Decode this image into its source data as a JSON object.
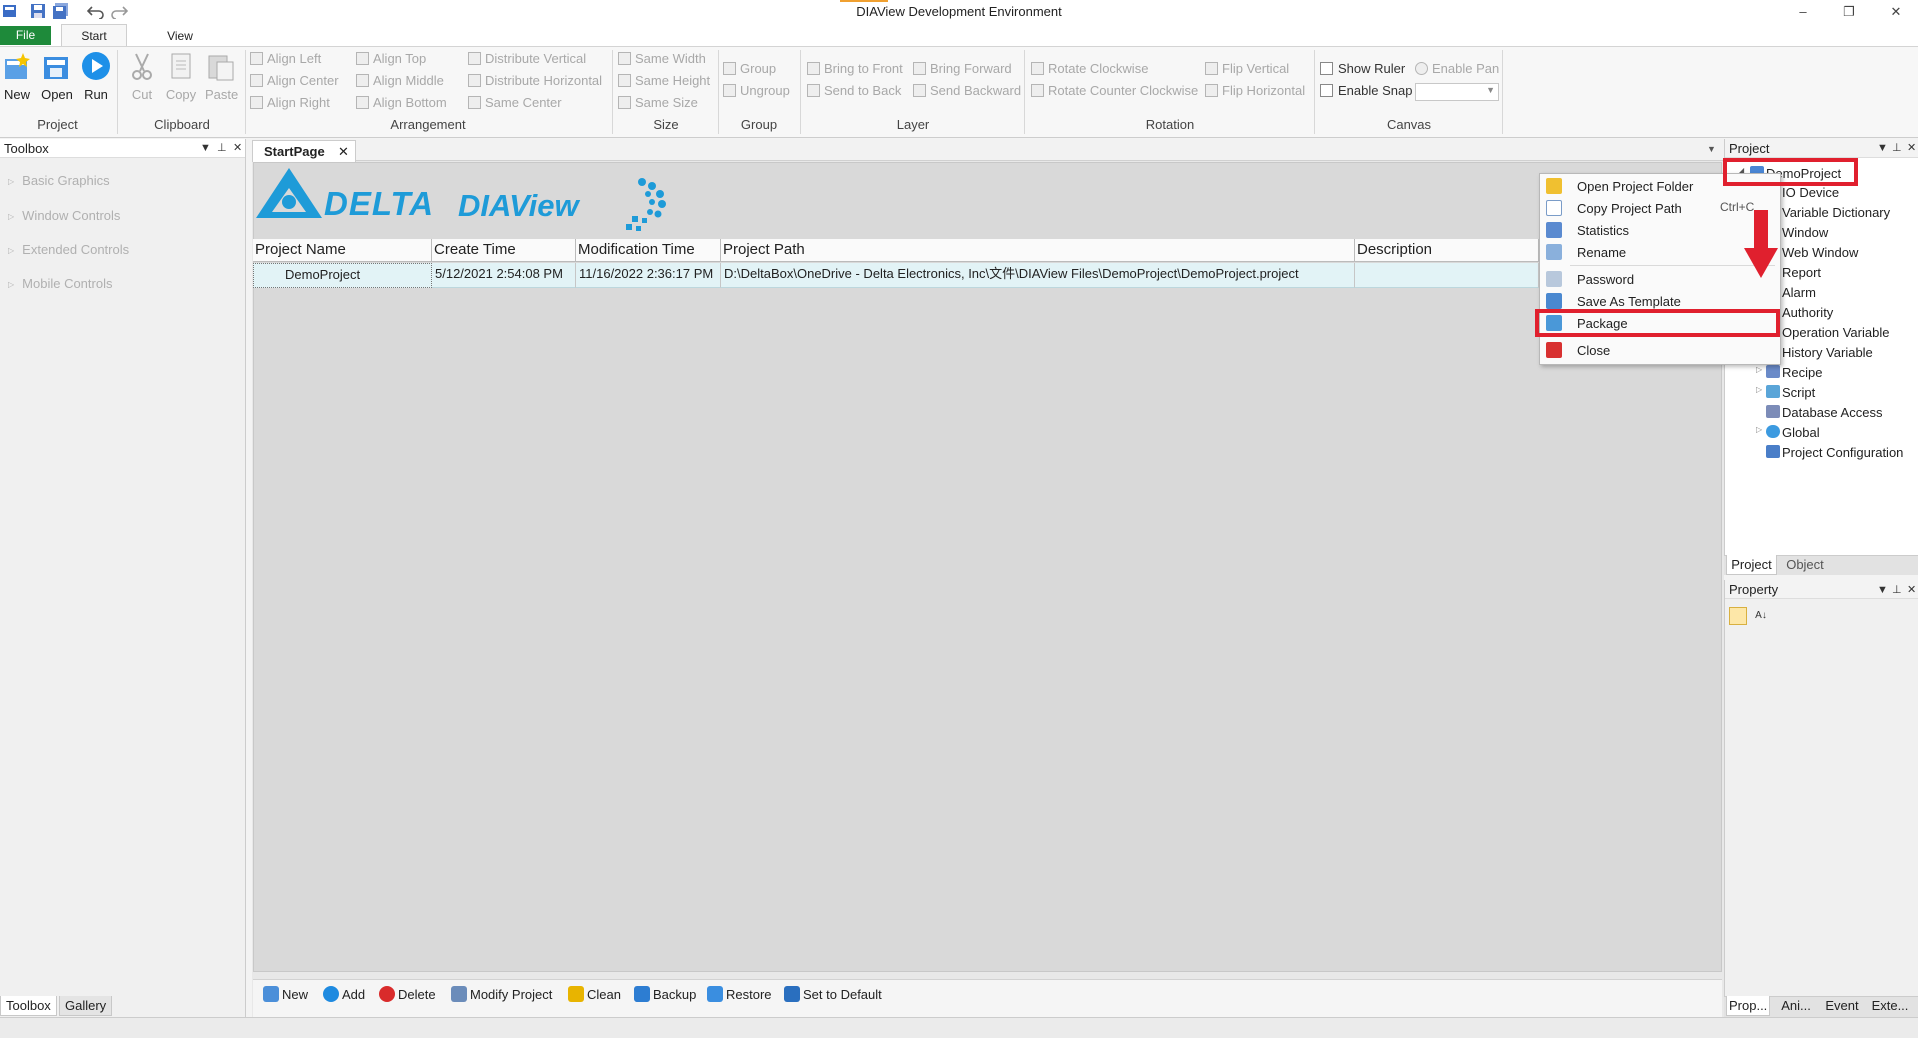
{
  "window": {
    "title": "DIAView Development Environment"
  },
  "menu_tabs": {
    "file": "File",
    "start": "Start",
    "view": "View"
  },
  "ribbon": {
    "project": {
      "label": "Project",
      "new": "New",
      "open": "Open",
      "run": "Run"
    },
    "clipboard": {
      "label": "Clipboard",
      "cut": "Cut",
      "copy": "Copy",
      "paste": "Paste"
    },
    "arrangement": {
      "label": "Arrangement",
      "align_left": "Align Left",
      "align_center": "Align Center",
      "align_right": "Align Right",
      "align_top": "Align Top",
      "align_middle": "Align Middle",
      "align_bottom": "Align Bottom",
      "distribute_vertical": "Distribute Vertical",
      "distribute_horizontal": "Distribute Horizontal",
      "same_center": "Same Center"
    },
    "size": {
      "label": "Size",
      "same_width": "Same Width",
      "same_height": "Same Height",
      "same_size": "Same Size"
    },
    "group": {
      "label": "Group",
      "group": "Group",
      "ungroup": "Ungroup"
    },
    "layer": {
      "label": "Layer",
      "bring_to_front": "Bring to Front",
      "send_to_back": "Send to Back",
      "bring_forward": "Bring Forward",
      "send_backward": "Send Backward"
    },
    "rotation": {
      "label": "Rotation",
      "rotate_cw": "Rotate Clockwise",
      "rotate_ccw": "Rotate Counter Clockwise",
      "flip_vertical": "Flip Vertical",
      "flip_horizontal": "Flip Horizontal"
    },
    "canvas": {
      "label": "Canvas",
      "show_ruler": "Show Ruler",
      "enable_snap": "Enable Snap",
      "enable_pan": "Enable Pan"
    }
  },
  "toolbox": {
    "title": "Toolbox",
    "categories": [
      "Basic Graphics",
      "Window Controls",
      "Extended Controls",
      "Mobile Controls"
    ],
    "bottom_tabs": [
      "Toolbox",
      "Gallery"
    ]
  },
  "document": {
    "tab": "StartPage",
    "logo": {
      "brand": "DELTA",
      "product": "DIAView"
    },
    "columns": [
      "Project Name",
      "Create Time",
      "Modification Time",
      "Project Path",
      "Description"
    ],
    "row": {
      "name": "DemoProject",
      "create_time": "5/12/2021 2:54:08 PM",
      "mod_time": "11/16/2022 2:36:17 PM",
      "path": "D:\\DeltaBox\\OneDrive - Delta Electronics, Inc\\文件\\DIAView Files\\DemoProject\\DemoProject.project",
      "description": ""
    },
    "footer_buttons": [
      "New",
      "Add",
      "Delete",
      "Modify Project",
      "Clean",
      "Backup",
      "Restore",
      "Set to Default"
    ]
  },
  "context_menu": {
    "items": [
      {
        "label": "Open Project Folder",
        "shortcut": ""
      },
      {
        "label": "Copy Project Path",
        "shortcut": "Ctrl+C"
      },
      {
        "label": "Statistics",
        "shortcut": ""
      },
      {
        "label": "Rename",
        "shortcut": ""
      },
      {
        "label": "Password",
        "shortcut": ""
      },
      {
        "label": "Save As Template",
        "shortcut": ""
      },
      {
        "label": "Package",
        "shortcut": ""
      },
      {
        "label": "Close",
        "shortcut": ""
      }
    ]
  },
  "project_panel": {
    "title": "Project",
    "root": "DemoProject",
    "nodes": [
      "IO Device",
      "Variable Dictionary",
      "Window",
      "Web Window",
      "Report",
      "Alarm",
      "Authority",
      "Operation Variable",
      "History Variable",
      "Recipe",
      "Script",
      "Database Access",
      "Global",
      "Project Configuration"
    ],
    "tabs": [
      "Project",
      "Object"
    ]
  },
  "property_panel": {
    "title": "Property",
    "bottom_tabs": [
      "Prop...",
      "Ani...",
      "Event",
      "Exte..."
    ]
  },
  "colors": {
    "highlight": "#e0202e",
    "brand_blue": "#1e9bd8",
    "file_tab": "#1e8a3a"
  }
}
